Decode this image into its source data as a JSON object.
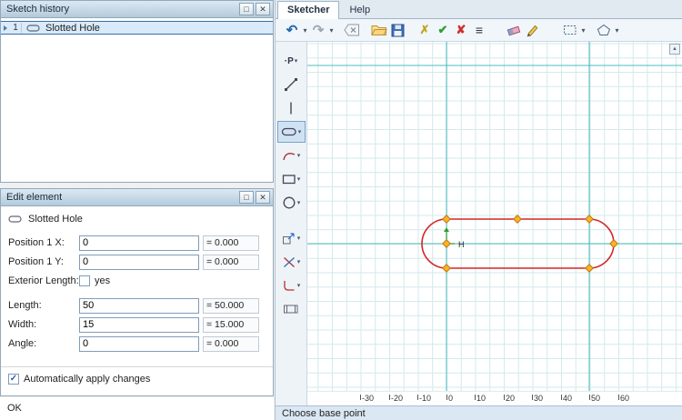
{
  "icons": {
    "caret_down": "▾",
    "undo": "↶",
    "redo": "↷",
    "cross_yellow": "✗",
    "check_green": "✔",
    "cross_red": "✘",
    "menu": "≡",
    "maximize": "□",
    "close": "✕",
    "check_small": "✓",
    "scroll_up": "▲",
    "point_tool": "·P"
  },
  "sketch_history": {
    "title": "Sketch history",
    "row": {
      "num": "1",
      "label": "Slotted Hole"
    }
  },
  "edit_element": {
    "title": "Edit element",
    "element_name": "Slotted Hole",
    "fields": [
      {
        "label": "Position 1 X:",
        "value": "0",
        "computed": "= 0.000"
      },
      {
        "label": "Position 1 Y:",
        "value": "0",
        "computed": "= 0.000"
      },
      {
        "label": "Exterior Length:",
        "option": "yes",
        "checked": false
      },
      {
        "label": "Length:",
        "value": "50",
        "computed": "= 50.000"
      },
      {
        "label": "Width:",
        "value": "15",
        "computed": "= 15.000"
      },
      {
        "label": "Angle:",
        "value": "0",
        "computed": "= 0.000"
      }
    ],
    "auto_apply_label": "Automatically apply changes",
    "auto_apply_checked": true,
    "footer_status": "OK"
  },
  "sketcher": {
    "tabs": [
      {
        "label": "Sketcher",
        "active": true
      },
      {
        "label": "Help",
        "active": false
      }
    ],
    "status": "Choose base point",
    "canvas": {
      "origin_label": "H",
      "ruler_labels": [
        "-30",
        "-20",
        "-10",
        "0",
        "10",
        "20",
        "30",
        "40",
        "50",
        "60"
      ],
      "shape": {
        "type": "slotted-hole",
        "length": 50,
        "width": 15,
        "color": "#d32727"
      },
      "colors": {
        "grid": "#d2e9eb",
        "reference_line": "#4cbcbe",
        "handle": "#ffb226"
      }
    }
  }
}
